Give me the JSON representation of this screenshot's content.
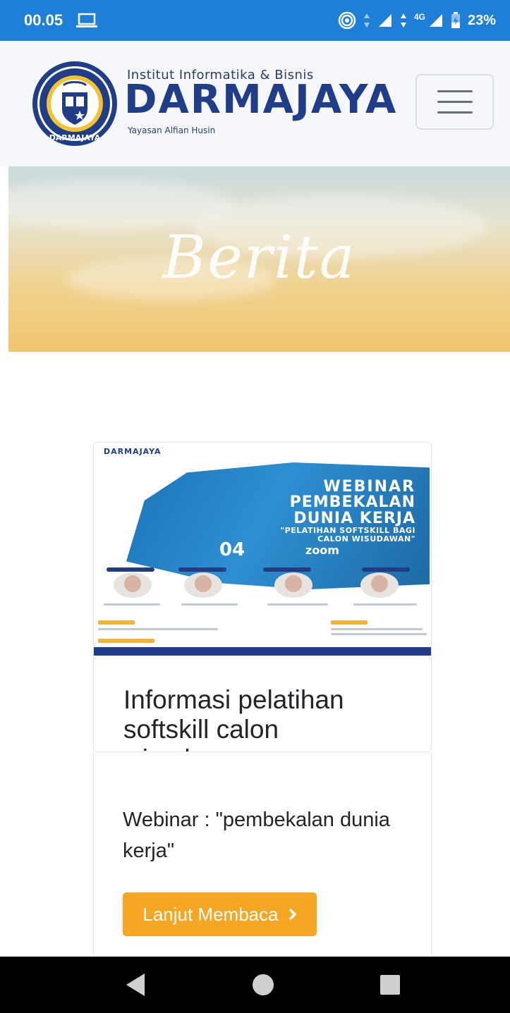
{
  "status_bar": {
    "time": "00.05",
    "network": "4G",
    "battery": "23%"
  },
  "header": {
    "institution_line": "Institut Informatika & Bisnis",
    "brand": "DARMAJAYA",
    "foundation": "Yayasan Alfian Husin",
    "logo_text": "DARMAJAYA"
  },
  "banner": {
    "title": "Berita"
  },
  "card": {
    "image": {
      "logo": "DARMAJAYA",
      "line1": "WEBINAR",
      "line2": "PEMBEKALAN",
      "line3": "DUNIA KERJA",
      "line4": "\"PELATIHAN SOFTSKILL BAGI",
      "line5": "CALON WISUDAWAN\"",
      "date_day": "04",
      "platform": "zoom"
    },
    "title": "Informasi pelatihan softskill calon wisudawan",
    "excerpt": "Webinar : \"pembekalan dunia kerja\"",
    "read_more": "Lanjut Membaca",
    "read_more_icon": "chevron-right-icon",
    "accent_color": "#f5a623"
  },
  "nav_bar": {
    "back_icon": "back-triangle-icon",
    "home_icon": "home-circle-icon",
    "recents_icon": "recents-square-icon"
  }
}
